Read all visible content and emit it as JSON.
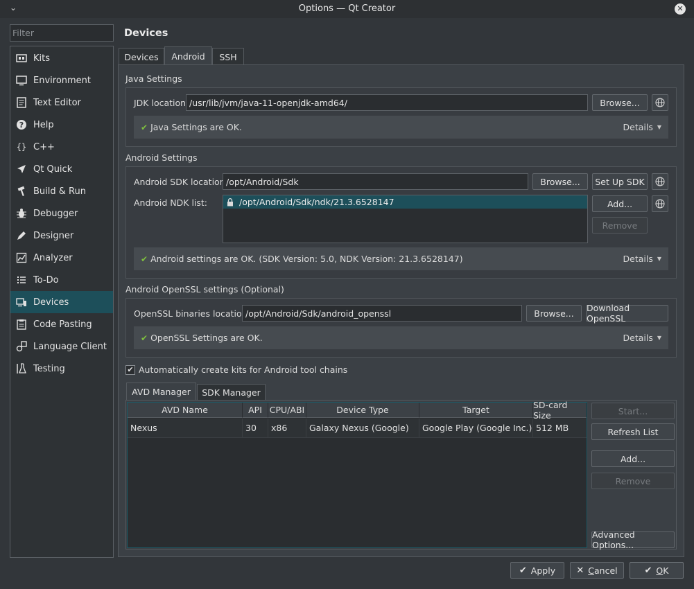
{
  "window": {
    "title": "Options — Qt Creator"
  },
  "filter": {
    "placeholder": "Filter"
  },
  "sidebar": {
    "items": [
      {
        "label": "Kits",
        "icon": "kits-icon"
      },
      {
        "label": "Environment",
        "icon": "monitor-icon"
      },
      {
        "label": "Text Editor",
        "icon": "text-editor-icon"
      },
      {
        "label": "Help",
        "icon": "help-icon"
      },
      {
        "label": "C++",
        "icon": "braces-icon"
      },
      {
        "label": "Qt Quick",
        "icon": "qt-quick-icon"
      },
      {
        "label": "Build & Run",
        "icon": "hammer-icon"
      },
      {
        "label": "Debugger",
        "icon": "bug-icon"
      },
      {
        "label": "Designer",
        "icon": "pen-icon"
      },
      {
        "label": "Analyzer",
        "icon": "chart-icon"
      },
      {
        "label": "To-Do",
        "icon": "todo-list-icon"
      },
      {
        "label": "Devices",
        "icon": "devices-icon",
        "active": true
      },
      {
        "label": "Code Pasting",
        "icon": "code-paste-icon"
      },
      {
        "label": "Language Client",
        "icon": "language-client-icon"
      },
      {
        "label": "Testing",
        "icon": "flask-icon"
      }
    ]
  },
  "page": {
    "title": "Devices",
    "tabs": [
      "Devices",
      "Android",
      "SSH"
    ],
    "active_tab": "Android"
  },
  "java": {
    "group_title": "Java Settings",
    "jdk_label": "JDK location:",
    "jdk_value": "/usr/lib/jvm/java-11-openjdk-amd64/",
    "browse": "Browse...",
    "status": "Java Settings are OK.",
    "details": "Details"
  },
  "android": {
    "group_title": "Android Settings",
    "sdk_label": "Android SDK location:",
    "sdk_value": "/opt/Android/Sdk",
    "browse": "Browse...",
    "setup_sdk": "Set Up SDK",
    "ndk_label": "Android NDK list:",
    "ndk_items": [
      "/opt/Android/Sdk/ndk/21.3.6528147"
    ],
    "add": "Add...",
    "remove": "Remove",
    "status": "Android settings are OK. (SDK Version: 5.0, NDK Version: 21.3.6528147)",
    "details": "Details"
  },
  "openssl": {
    "group_title": "Android OpenSSL settings (Optional)",
    "label": "OpenSSL binaries location:",
    "value": "/opt/Android/Sdk/android_openssl",
    "browse": "Browse...",
    "download": "Download OpenSSL",
    "status": "OpenSSL Settings are OK.",
    "details": "Details"
  },
  "auto_kits": {
    "label": "Automatically create kits for Android tool chains",
    "checked": true
  },
  "avd": {
    "tabs": [
      "AVD Manager",
      "SDK Manager"
    ],
    "active_tab": "AVD Manager",
    "columns": [
      "AVD Name",
      "API",
      "CPU/ABI",
      "Device Type",
      "Target",
      "SD-card Size"
    ],
    "rows": [
      [
        "Nexus",
        "30",
        "x86",
        "Galaxy Nexus (Google)",
        "Google Play (Google Inc.)",
        "512 MB"
      ]
    ],
    "buttons": {
      "start": "Start...",
      "refresh": "Refresh List",
      "add": "Add...",
      "remove": "Remove",
      "advanced": "Advanced Options..."
    }
  },
  "footer": {
    "apply": "Apply",
    "cancel_prefix": "",
    "cancel_mnemonic": "C",
    "cancel_rest": "ancel",
    "ok_mnemonic": "O",
    "ok_rest": "K"
  }
}
